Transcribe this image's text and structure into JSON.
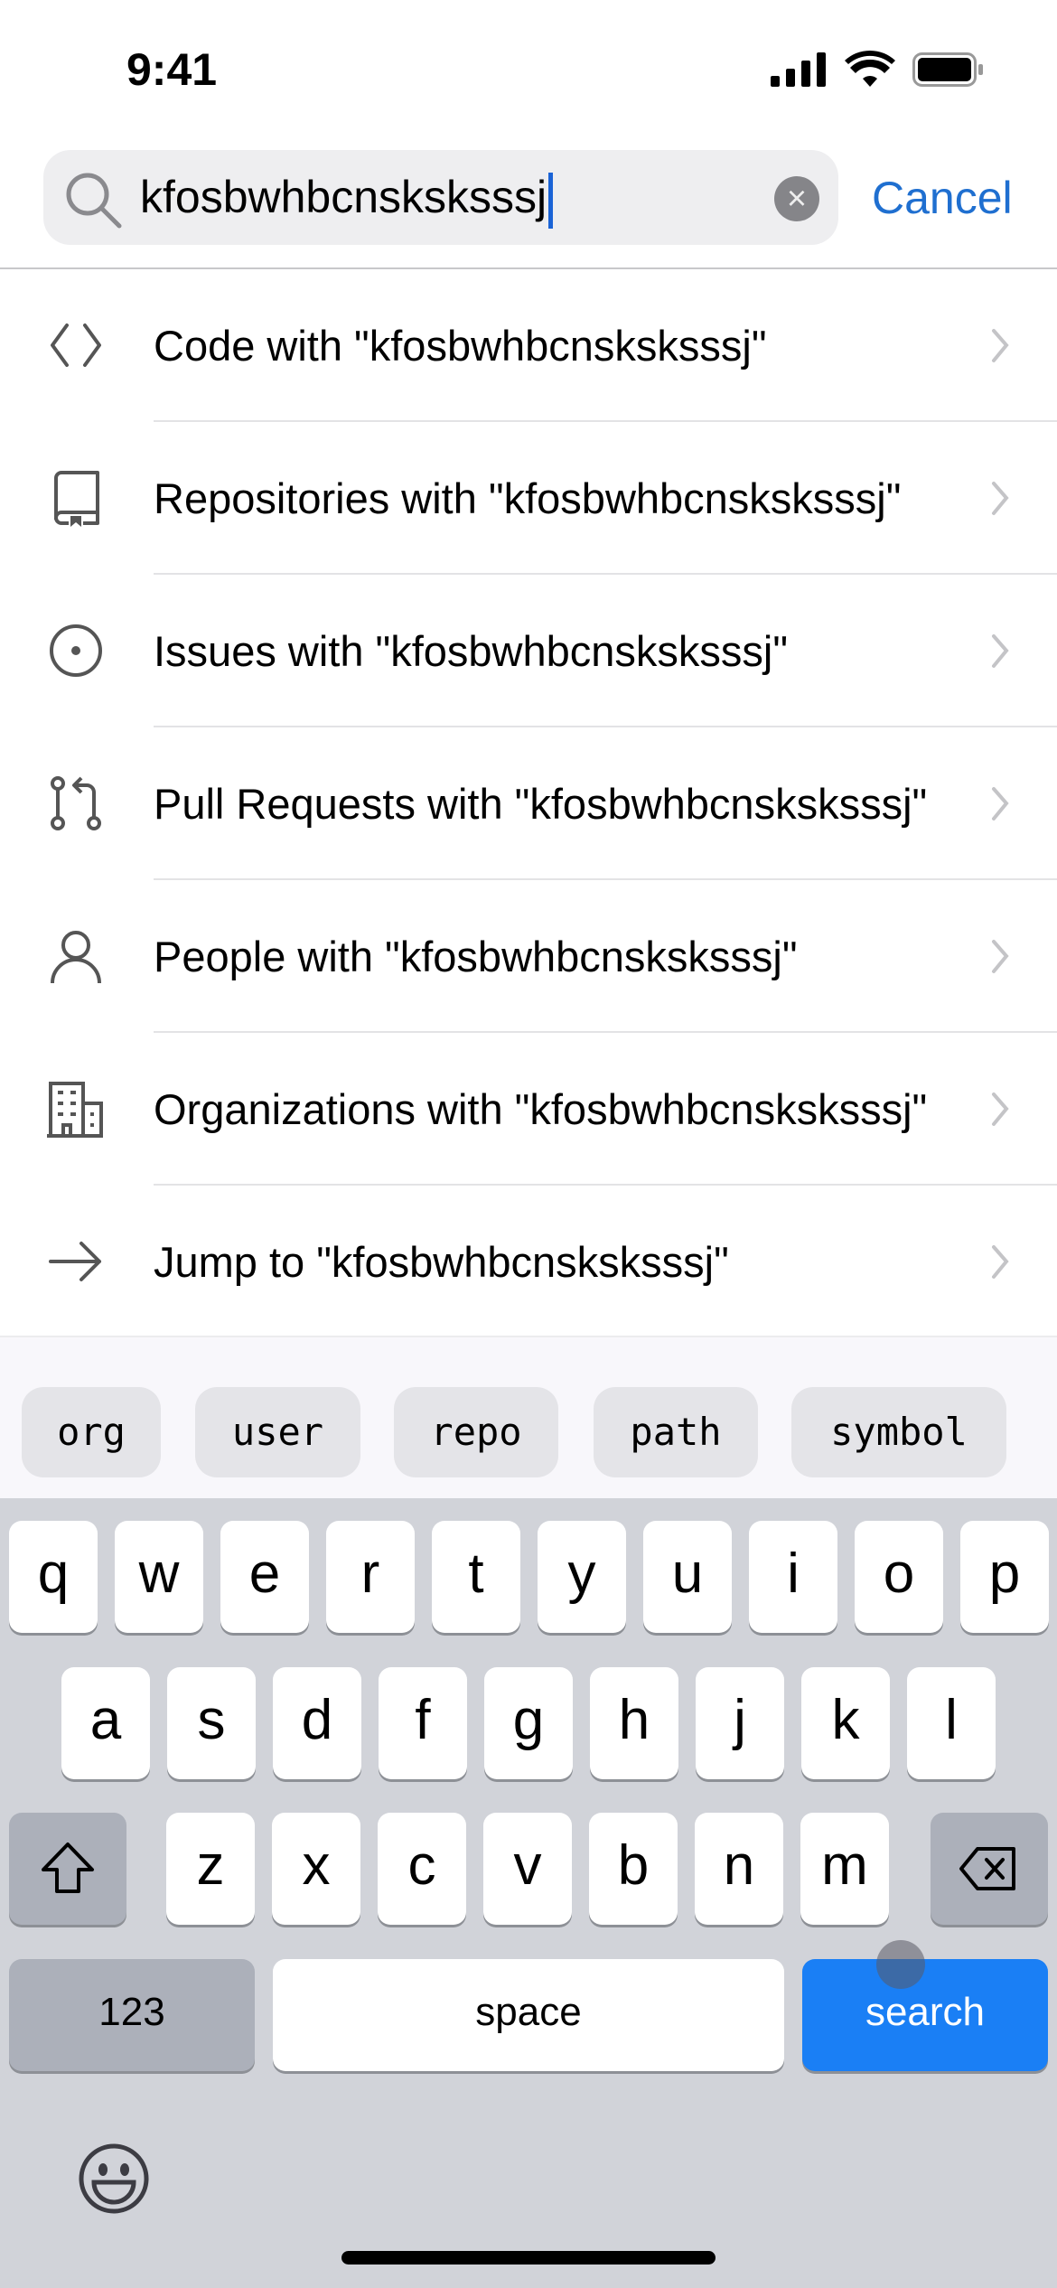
{
  "status_bar": {
    "time": "9:41",
    "icons": [
      "cellular-signal-icon",
      "wifi-icon",
      "battery-icon"
    ]
  },
  "search": {
    "query": "kfosbwhbcnsksksssj",
    "cancel_label": "Cancel"
  },
  "results": [
    {
      "icon": "code-icon",
      "label": "Code with \"kfosbwhbcnsksksssj\""
    },
    {
      "icon": "repo-icon",
      "label": "Repositories with \"kfosbwhbcnsksksssj\""
    },
    {
      "icon": "issue-icon",
      "label": "Issues with \"kfosbwhbcnsksksssj\""
    },
    {
      "icon": "pull-request-icon",
      "label": "Pull Requests with \"kfosbwhbcnsksksssj\""
    },
    {
      "icon": "person-icon",
      "label": "People with \"kfosbwhbcnsksksssj\""
    },
    {
      "icon": "organization-icon",
      "label": "Organizations with \"kfosbwhbcnsksksssj\""
    },
    {
      "icon": "arrow-right-icon",
      "label": "Jump to \"kfosbwhbcnsksksssj\""
    }
  ],
  "qualifiers": [
    "org",
    "user",
    "repo",
    "path",
    "symbol"
  ],
  "keyboard": {
    "row1": [
      "q",
      "w",
      "e",
      "r",
      "t",
      "y",
      "u",
      "i",
      "o",
      "p"
    ],
    "row2": [
      "a",
      "s",
      "d",
      "f",
      "g",
      "h",
      "j",
      "k",
      "l"
    ],
    "row3": [
      "z",
      "x",
      "c",
      "v",
      "b",
      "n",
      "m"
    ],
    "numbers_label": "123",
    "space_label": "space",
    "search_label": "search"
  },
  "colors": {
    "accent": "#1f6fd0",
    "search_key": "#1a7ff5",
    "keyboard_bg": "#d1d3d9"
  }
}
